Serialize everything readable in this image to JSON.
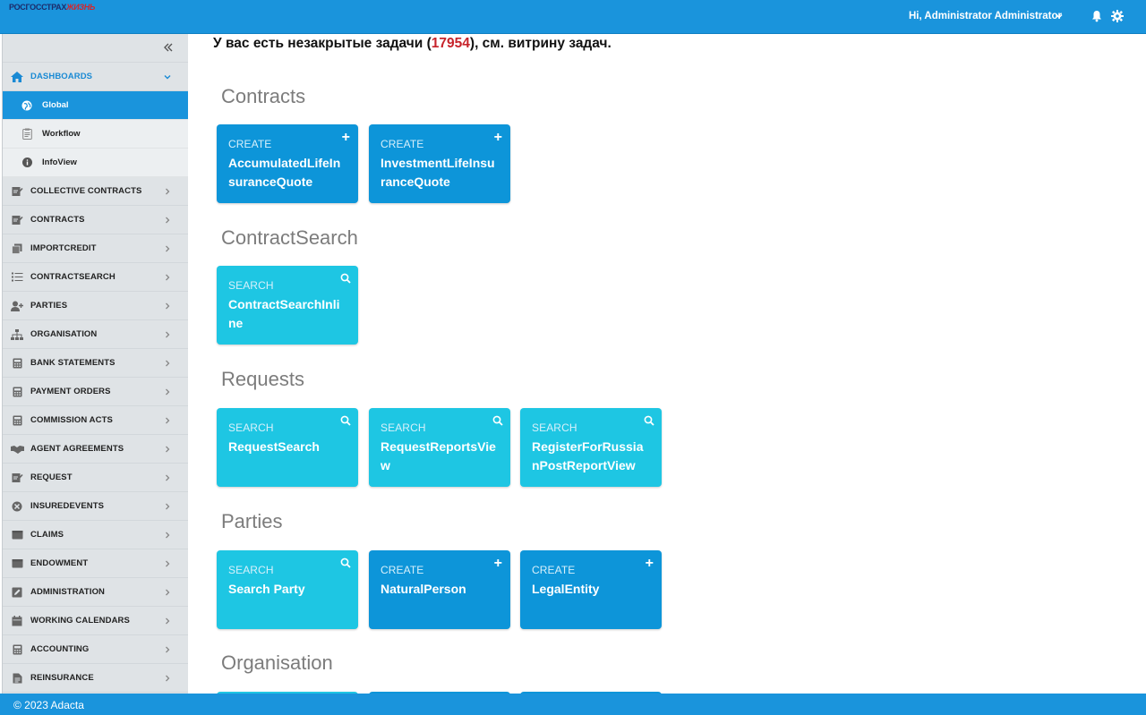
{
  "header": {
    "logo_part1": "РОСГОССТРАХ",
    "logo_part2": "ЖИЗНЬ",
    "user_greeting": "Hi, Administrator Administrator"
  },
  "sidebar": {
    "dashboards": {
      "label": "DASHBOARDS",
      "icon": "home-icon"
    },
    "subitems": [
      {
        "label": "Global",
        "icon": "globe-icon",
        "active": true
      },
      {
        "label": "Workflow",
        "icon": "clipboard-icon"
      },
      {
        "label": "InfoView",
        "icon": "info-icon"
      }
    ],
    "items": [
      {
        "label": "COLLECTIVE CONTRACTS",
        "icon": "signature-icon"
      },
      {
        "label": "CONTRACTS",
        "icon": "signature-icon"
      },
      {
        "label": "IMPORTCREDIT",
        "icon": "copy-icon"
      },
      {
        "label": "CONTRACTSEARCH",
        "icon": "list-icon"
      },
      {
        "label": "PARTIES",
        "icon": "user-plus-icon"
      },
      {
        "label": "ORGANISATION",
        "icon": "sitemap-icon"
      },
      {
        "label": "BANK STATEMENTS",
        "icon": "calculator-icon"
      },
      {
        "label": "PAYMENT ORDERS",
        "icon": "calculator-icon"
      },
      {
        "label": "COMMISSION ACTS",
        "icon": "calculator-icon"
      },
      {
        "label": "AGENT AGREEMENTS",
        "icon": "handshake-icon"
      },
      {
        "label": "REQUEST",
        "icon": "signature-icon"
      },
      {
        "label": "INSUREDEVENTS",
        "icon": "cross-circle-icon"
      },
      {
        "label": "CLAIMS",
        "icon": "wallet-icon"
      },
      {
        "label": "ENDOWMENT",
        "icon": "wallet-icon"
      },
      {
        "label": "ADMINISTRATION",
        "icon": "edit-icon"
      },
      {
        "label": "WORKING CALENDARS",
        "icon": "calendar-icon"
      },
      {
        "label": "ACCOUNTING",
        "icon": "calculator-icon"
      },
      {
        "label": "REINSURANCE",
        "icon": "file-icon"
      }
    ]
  },
  "main": {
    "notice_before": "У вас есть незакрытые задачи (",
    "notice_count": "17954",
    "notice_after": "), см. витрину задач.",
    "sections": [
      {
        "title": "Contracts",
        "tiles": [
          {
            "kind": "CREATE",
            "name": "AccumulatedLifeInsuranceQuote"
          },
          {
            "kind": "CREATE",
            "name": "InvestmentLifeInsuranceQuote"
          }
        ]
      },
      {
        "title": "ContractSearch",
        "tiles": [
          {
            "kind": "SEARCH",
            "name": "ContractSearchInline"
          }
        ]
      },
      {
        "title": "Requests",
        "tiles": [
          {
            "kind": "SEARCH",
            "name": "RequestSearch"
          },
          {
            "kind": "SEARCH",
            "name": "RequestReportsView"
          },
          {
            "kind": "SEARCH",
            "name": "RegisterForRussianPostReportView"
          }
        ]
      },
      {
        "title": "Parties",
        "tiles": [
          {
            "kind": "SEARCH",
            "name": "Search Party"
          },
          {
            "kind": "CREATE",
            "name": "NaturalPerson"
          },
          {
            "kind": "CREATE",
            "name": "LegalEntity"
          }
        ]
      },
      {
        "title": "Organisation",
        "tiles": []
      }
    ]
  },
  "footer": {
    "text": "© 2023 Adacta"
  },
  "colors": {
    "brand": "#1a94dc",
    "create_tile": "#0d95d9",
    "search_tile": "#1ec6e3",
    "highlight": "#c7232b"
  }
}
